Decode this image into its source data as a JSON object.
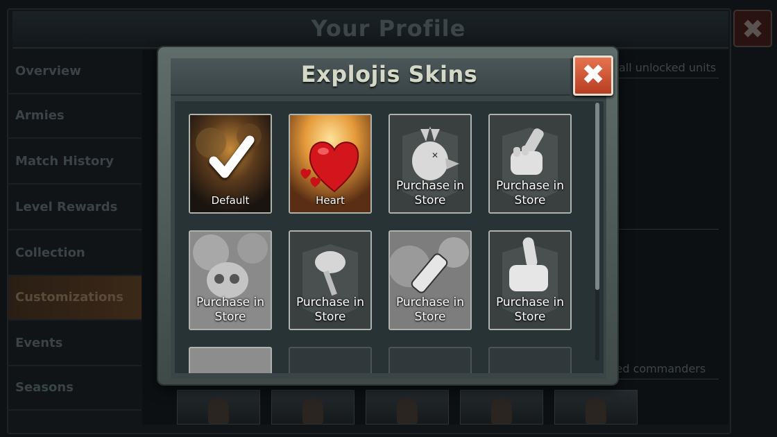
{
  "background": {
    "title": "Your Profile",
    "close_label": "✖",
    "sidebar": [
      {
        "label": "Overview"
      },
      {
        "label": "Armies"
      },
      {
        "label": "Match History"
      },
      {
        "label": "Level Rewards"
      },
      {
        "label": "Collection"
      },
      {
        "label": "Customizations",
        "active": true
      },
      {
        "label": "Events"
      },
      {
        "label": "Seasons"
      }
    ],
    "hint_units": "all unlocked units",
    "hint_commanders": "cked commanders"
  },
  "modal": {
    "title": "Explojis Skins",
    "close_label": "✖",
    "tiles": [
      {
        "label": "Default",
        "icon": "checkmark-icon",
        "owned": true,
        "selected": true
      },
      {
        "label": "Heart",
        "icon": "heart-icon",
        "owned": true
      },
      {
        "label": "Purchase in Store",
        "icon": "dead-bird-icon",
        "owned": false
      },
      {
        "label": "Purchase in Store",
        "icon": "fist-icon",
        "owned": false
      },
      {
        "label": "Purchase in Store",
        "icon": "skull-icon",
        "owned": false
      },
      {
        "label": "Purchase in Store",
        "icon": "plunger-icon",
        "owned": false
      },
      {
        "label": "Purchase in Store",
        "icon": "bottle-icon",
        "owned": false
      },
      {
        "label": "Purchase in Store",
        "icon": "thumbs-up-icon",
        "owned": false
      }
    ]
  },
  "colors": {
    "accent_close": "#d1552f",
    "tile_border": "#aeb3ae",
    "modal_frame": "#56635f"
  }
}
